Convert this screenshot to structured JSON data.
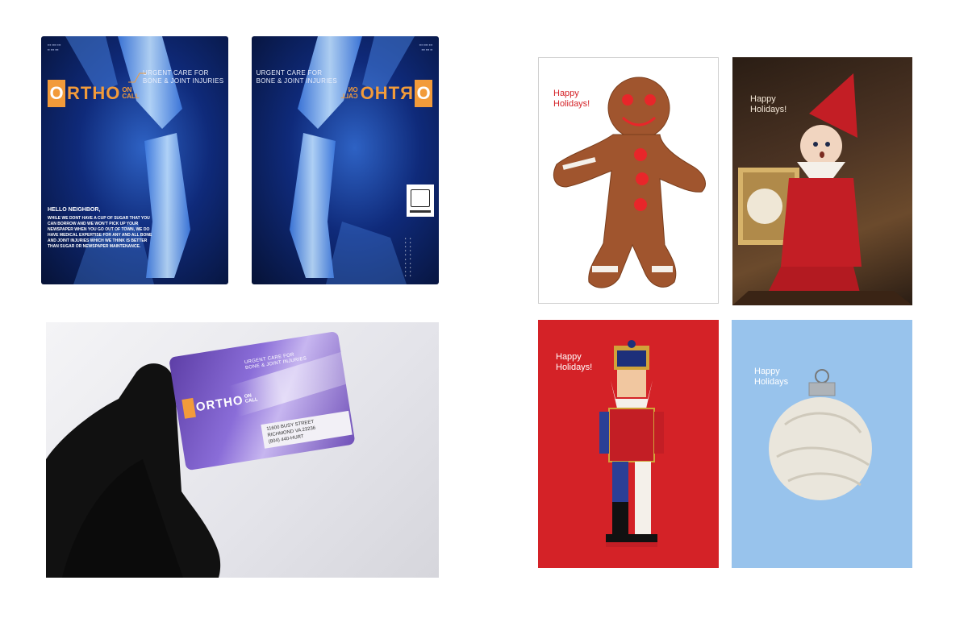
{
  "mailers": {
    "brand_o": "O",
    "brand_rest": "RTHO",
    "brand_on": "ON",
    "brand_call": "CALL",
    "tagline_line1": "URGENT CARE FOR",
    "tagline_line2": "BONE & JOINT INJURIES",
    "front": {
      "heading": "HELLO NEIGHBOR,",
      "body": "WHILE WE DONT HAVE A CUP OF SUGAR THAT YOU CAN BORROW AND WE WON'T PICK UP YOUR NEWSPAPER WHEN YOU GO OUT OF TOWN, WE DO HAVE MEDICAL EXPERTISE FOR ANY AND ALL BONE AND JOINT INJURIES WHICH WE THINK IS BETTER THAN SUGAR OR NEWSPAPER MAINTENANCE."
    }
  },
  "card_photo": {
    "brand": "ORTHO",
    "brand_on": "ON",
    "brand_call": "CALL",
    "tagline_line1": "URGENT CARE FOR",
    "tagline_line2": "BONE & JOINT INJURIES",
    "address_line1": "11600 BUSY STREET",
    "address_line2": "RICHMOND VA 23236",
    "phone": "(804) 440-HURT"
  },
  "holiday_cards": [
    {
      "text_line1": "Happy",
      "text_line2": "Holidays!",
      "color": "#d42227"
    },
    {
      "text_line1": "Happy",
      "text_line2": "Holidays!",
      "color": "#f3e6d6"
    },
    {
      "text_line1": "Happy",
      "text_line2": "Holidays!",
      "color": "#ffffff"
    },
    {
      "text_line1": "Happy",
      "text_line2": "Holidays",
      "color": "#ffffff"
    }
  ],
  "colors": {
    "ortho_orange": "#f29b3a",
    "xray_blue": "#0f2a7a",
    "holiday_red": "#d42227",
    "holiday_blue": "#98c3ec"
  }
}
